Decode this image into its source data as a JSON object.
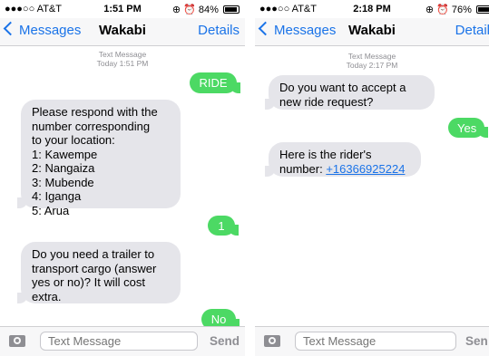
{
  "colors": {
    "ios_blue": "#1a73e8",
    "sms_green": "#4cd964",
    "incoming_gray": "#e5e5ea"
  },
  "left": {
    "status": {
      "carrier": "●●●○○ AT&T",
      "time": "1:51 PM",
      "battery": "84%",
      "battery_level": 0.84
    },
    "nav": {
      "back": "Messages",
      "title": "Wakabi",
      "details": "Details"
    },
    "timestamp": {
      "line1": "Text Message",
      "line2": "Today 1:51 PM"
    },
    "messages": [
      {
        "text": "RIDE"
      },
      {
        "lines": [
          "Please respond with the",
          "number corresponding",
          "to your location:",
          "1: Kawempe",
          "2: Nangaiza",
          "3: Mubende",
          "4: Iganga",
          "5: Arua"
        ]
      },
      {
        "text": "1"
      },
      {
        "lines": [
          "Do you need a trailer to",
          "transport cargo (answer",
          "yes or no)? It will cost",
          "extra."
        ]
      },
      {
        "text": "No"
      }
    ],
    "input": {
      "placeholder": "Text Message",
      "send": "Send"
    }
  },
  "right": {
    "status": {
      "carrier": "●●●○○ AT&T",
      "time": "2:18 PM",
      "battery": "76%",
      "battery_level": 0.76
    },
    "nav": {
      "back": "Messages",
      "title": "Wakabi",
      "details": "Detail"
    },
    "timestamp": {
      "line1": "Text Message",
      "line2": "Today 2:17 PM"
    },
    "messages": [
      {
        "lines": [
          "Do you want to accept a",
          "new ride request?"
        ]
      },
      {
        "text": "Yes"
      },
      {
        "line1": "Here is the rider's",
        "line2_prefix": "number: ",
        "phone": "+16366925224"
      }
    ],
    "input": {
      "placeholder": "Text Message",
      "send": "Sen"
    }
  }
}
